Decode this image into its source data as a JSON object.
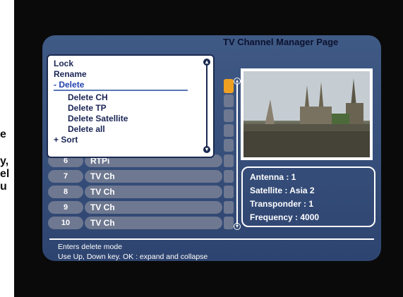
{
  "page_title": "TV Channel Manager Page",
  "left_cropped_text": [
    "e",
    "y,",
    "el",
    "u"
  ],
  "context_menu": {
    "items": [
      {
        "label": "Lock",
        "level": 0
      },
      {
        "label": "Rename",
        "level": 0
      },
      {
        "label": "Delete",
        "level": 0,
        "prefix": "-",
        "active": true
      },
      {
        "label": "Delete CH",
        "level": 1
      },
      {
        "label": "Delete TP",
        "level": 1
      },
      {
        "label": "Delete Satellite",
        "level": 1
      },
      {
        "label": "Delete all",
        "level": 1
      },
      {
        "label": "Sort",
        "level": 0,
        "prefix": "+"
      }
    ]
  },
  "channels": [
    {
      "num": "6",
      "name": "RTPi"
    },
    {
      "num": "7",
      "name": "TV Ch"
    },
    {
      "num": "8",
      "name": "TV Ch"
    },
    {
      "num": "9",
      "name": "TV Ch"
    },
    {
      "num": "10",
      "name": "TV Ch"
    }
  ],
  "info": {
    "antenna": "Antenna : 1",
    "satellite": "Satellite : Asia 2",
    "transponder": "Transponder : 1",
    "frequency": "Frequency : 4000"
  },
  "help": {
    "line1": "Enters delete mode",
    "line2": "Use Up, Down key. OK : expand and collapse"
  },
  "colors": {
    "panel": "#3f5a85",
    "row": "#6e7890",
    "selected_accent": "#f0a020",
    "menu_active": "#2040b0"
  }
}
